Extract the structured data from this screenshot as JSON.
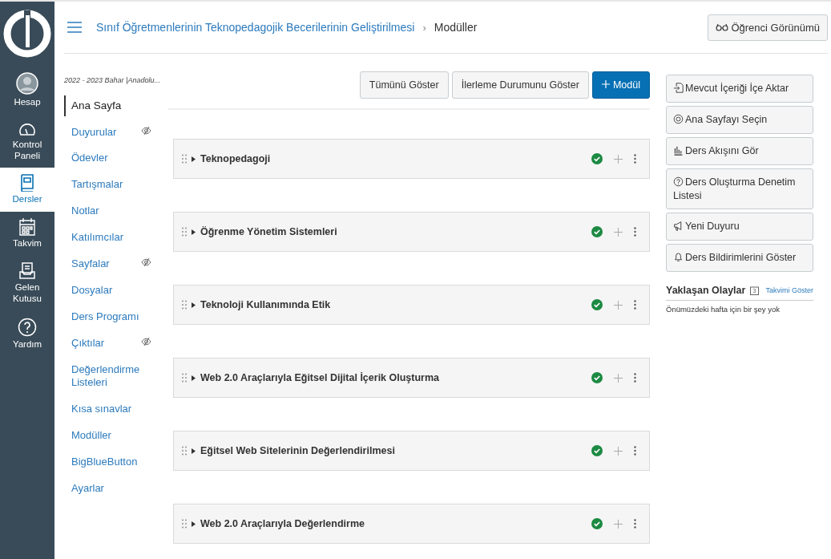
{
  "global_nav": [
    {
      "label": "Hesap",
      "selected": false
    },
    {
      "label": "Kontrol Paneli",
      "selected": false
    },
    {
      "label": "Dersler",
      "selected": true
    },
    {
      "label": "Takvim",
      "selected": false
    },
    {
      "label": "Gelen Kutusu",
      "selected": false
    },
    {
      "label": "Yardım",
      "selected": false
    }
  ],
  "breadcrumb": {
    "course": "Sınıf Öğretmenlerinin Teknopedagojik Becerilerinin Geliştirilmesi",
    "separator": "›",
    "page": "Modüller"
  },
  "student_view_button": "Öğrenci Görünümü",
  "course_nav": {
    "term": "2022 - 2023 Bahar |Anadolu...",
    "items": [
      {
        "label": "Ana Sayfa",
        "selected": true,
        "hidden": false
      },
      {
        "label": "Duyurular",
        "selected": false,
        "hidden": true
      },
      {
        "label": "Ödevler",
        "selected": false,
        "hidden": false
      },
      {
        "label": "Tartışmalar",
        "selected": false,
        "hidden": false
      },
      {
        "label": "Notlar",
        "selected": false,
        "hidden": false
      },
      {
        "label": "Katılımcılar",
        "selected": false,
        "hidden": false
      },
      {
        "label": "Sayfalar",
        "selected": false,
        "hidden": true
      },
      {
        "label": "Dosyalar",
        "selected": false,
        "hidden": false
      },
      {
        "label": "Ders Programı",
        "selected": false,
        "hidden": false
      },
      {
        "label": "Çıktılar",
        "selected": false,
        "hidden": true
      },
      {
        "label": "Değerlendirme Listeleri",
        "selected": false,
        "hidden": false
      },
      {
        "label": "Kısa sınavlar",
        "selected": false,
        "hidden": false
      },
      {
        "label": "Modüller",
        "selected": false,
        "hidden": false
      },
      {
        "label": "BigBlueButton",
        "selected": false,
        "hidden": false
      },
      {
        "label": "Ayarlar",
        "selected": false,
        "hidden": false
      }
    ]
  },
  "toolbar": [
    {
      "label": "Tümünü Göster",
      "kind": "plain"
    },
    {
      "label": "İlerleme Durumunu Göster",
      "kind": "plain"
    },
    {
      "label": "Modül",
      "kind": "primary"
    }
  ],
  "modules": [
    {
      "title": "Teknopedagoji",
      "published": true
    },
    {
      "title": "Öğrenme Yönetim Sistemleri",
      "published": true
    },
    {
      "title": "Teknoloji Kullanımında Etik",
      "published": true
    },
    {
      "title": "Web 2.0 Araçlarıyla Eğitsel Dijital İçerik Oluşturma",
      "published": true
    },
    {
      "title": "Eğitsel Web Sitelerinin Değerlendirilmesi",
      "published": true
    },
    {
      "title": "Web 2.0 Araçlarıyla Değerlendirme",
      "published": true
    }
  ],
  "sidebar_buttons": [
    {
      "label": "Mevcut İçeriği İçe Aktar"
    },
    {
      "label": "Ana Sayfayı Seçin"
    },
    {
      "label": "Ders Akışını Gör"
    },
    {
      "label": "Ders Oluşturma Denetim Listesi"
    },
    {
      "label": "Yeni Duyuru"
    },
    {
      "label": "Ders Bildirimlerini Göster"
    }
  ],
  "upcoming": {
    "title": "Yaklaşan Olaylar",
    "calendar_day": "3",
    "calendar_link": "Takvimi Göster",
    "empty_message": "Önümüzdeki hafta için bir şey yok"
  }
}
